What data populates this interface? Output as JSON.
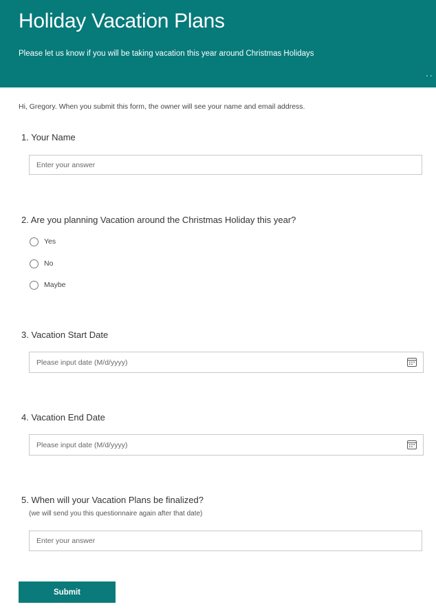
{
  "header": {
    "title": "Holiday Vacation Plans",
    "subtitle": "Please let us know if you will be taking vacation this year around Christmas Holidays",
    "more_icon": "ellipsis-icon",
    "more_glyph": "··"
  },
  "notice": "Hi, Gregory. When you submit this form, the owner will see your name and email address.",
  "colors": {
    "brand": "#077a7a",
    "submit": "#0b7a7a"
  },
  "questions": [
    {
      "number": "1.",
      "title": "1. Your Name",
      "type": "text",
      "placeholder": "Enter your answer",
      "value": ""
    },
    {
      "number": "2.",
      "title": "2. Are you planning Vacation around the Christmas Holiday this year?",
      "type": "choice",
      "options": [
        {
          "label": "Yes",
          "selected": false
        },
        {
          "label": "No",
          "selected": false
        },
        {
          "label": "Maybe",
          "selected": false
        }
      ]
    },
    {
      "number": "3.",
      "title": "3. Vacation Start Date",
      "type": "date",
      "placeholder": "Please input date (M/d/yyyy)",
      "value": "",
      "icon": "calendar-icon"
    },
    {
      "number": "4.",
      "title": "4. Vacation End Date",
      "type": "date",
      "placeholder": "Please input date (M/d/yyyy)",
      "value": "",
      "icon": "calendar-icon"
    },
    {
      "number": "5.",
      "title": "5. When will your Vacation Plans be finalized?",
      "subtitle": "(we will send you this questionnaire again after that date)",
      "type": "text",
      "placeholder": "Enter your answer",
      "value": ""
    }
  ],
  "submit_label": "Submit"
}
